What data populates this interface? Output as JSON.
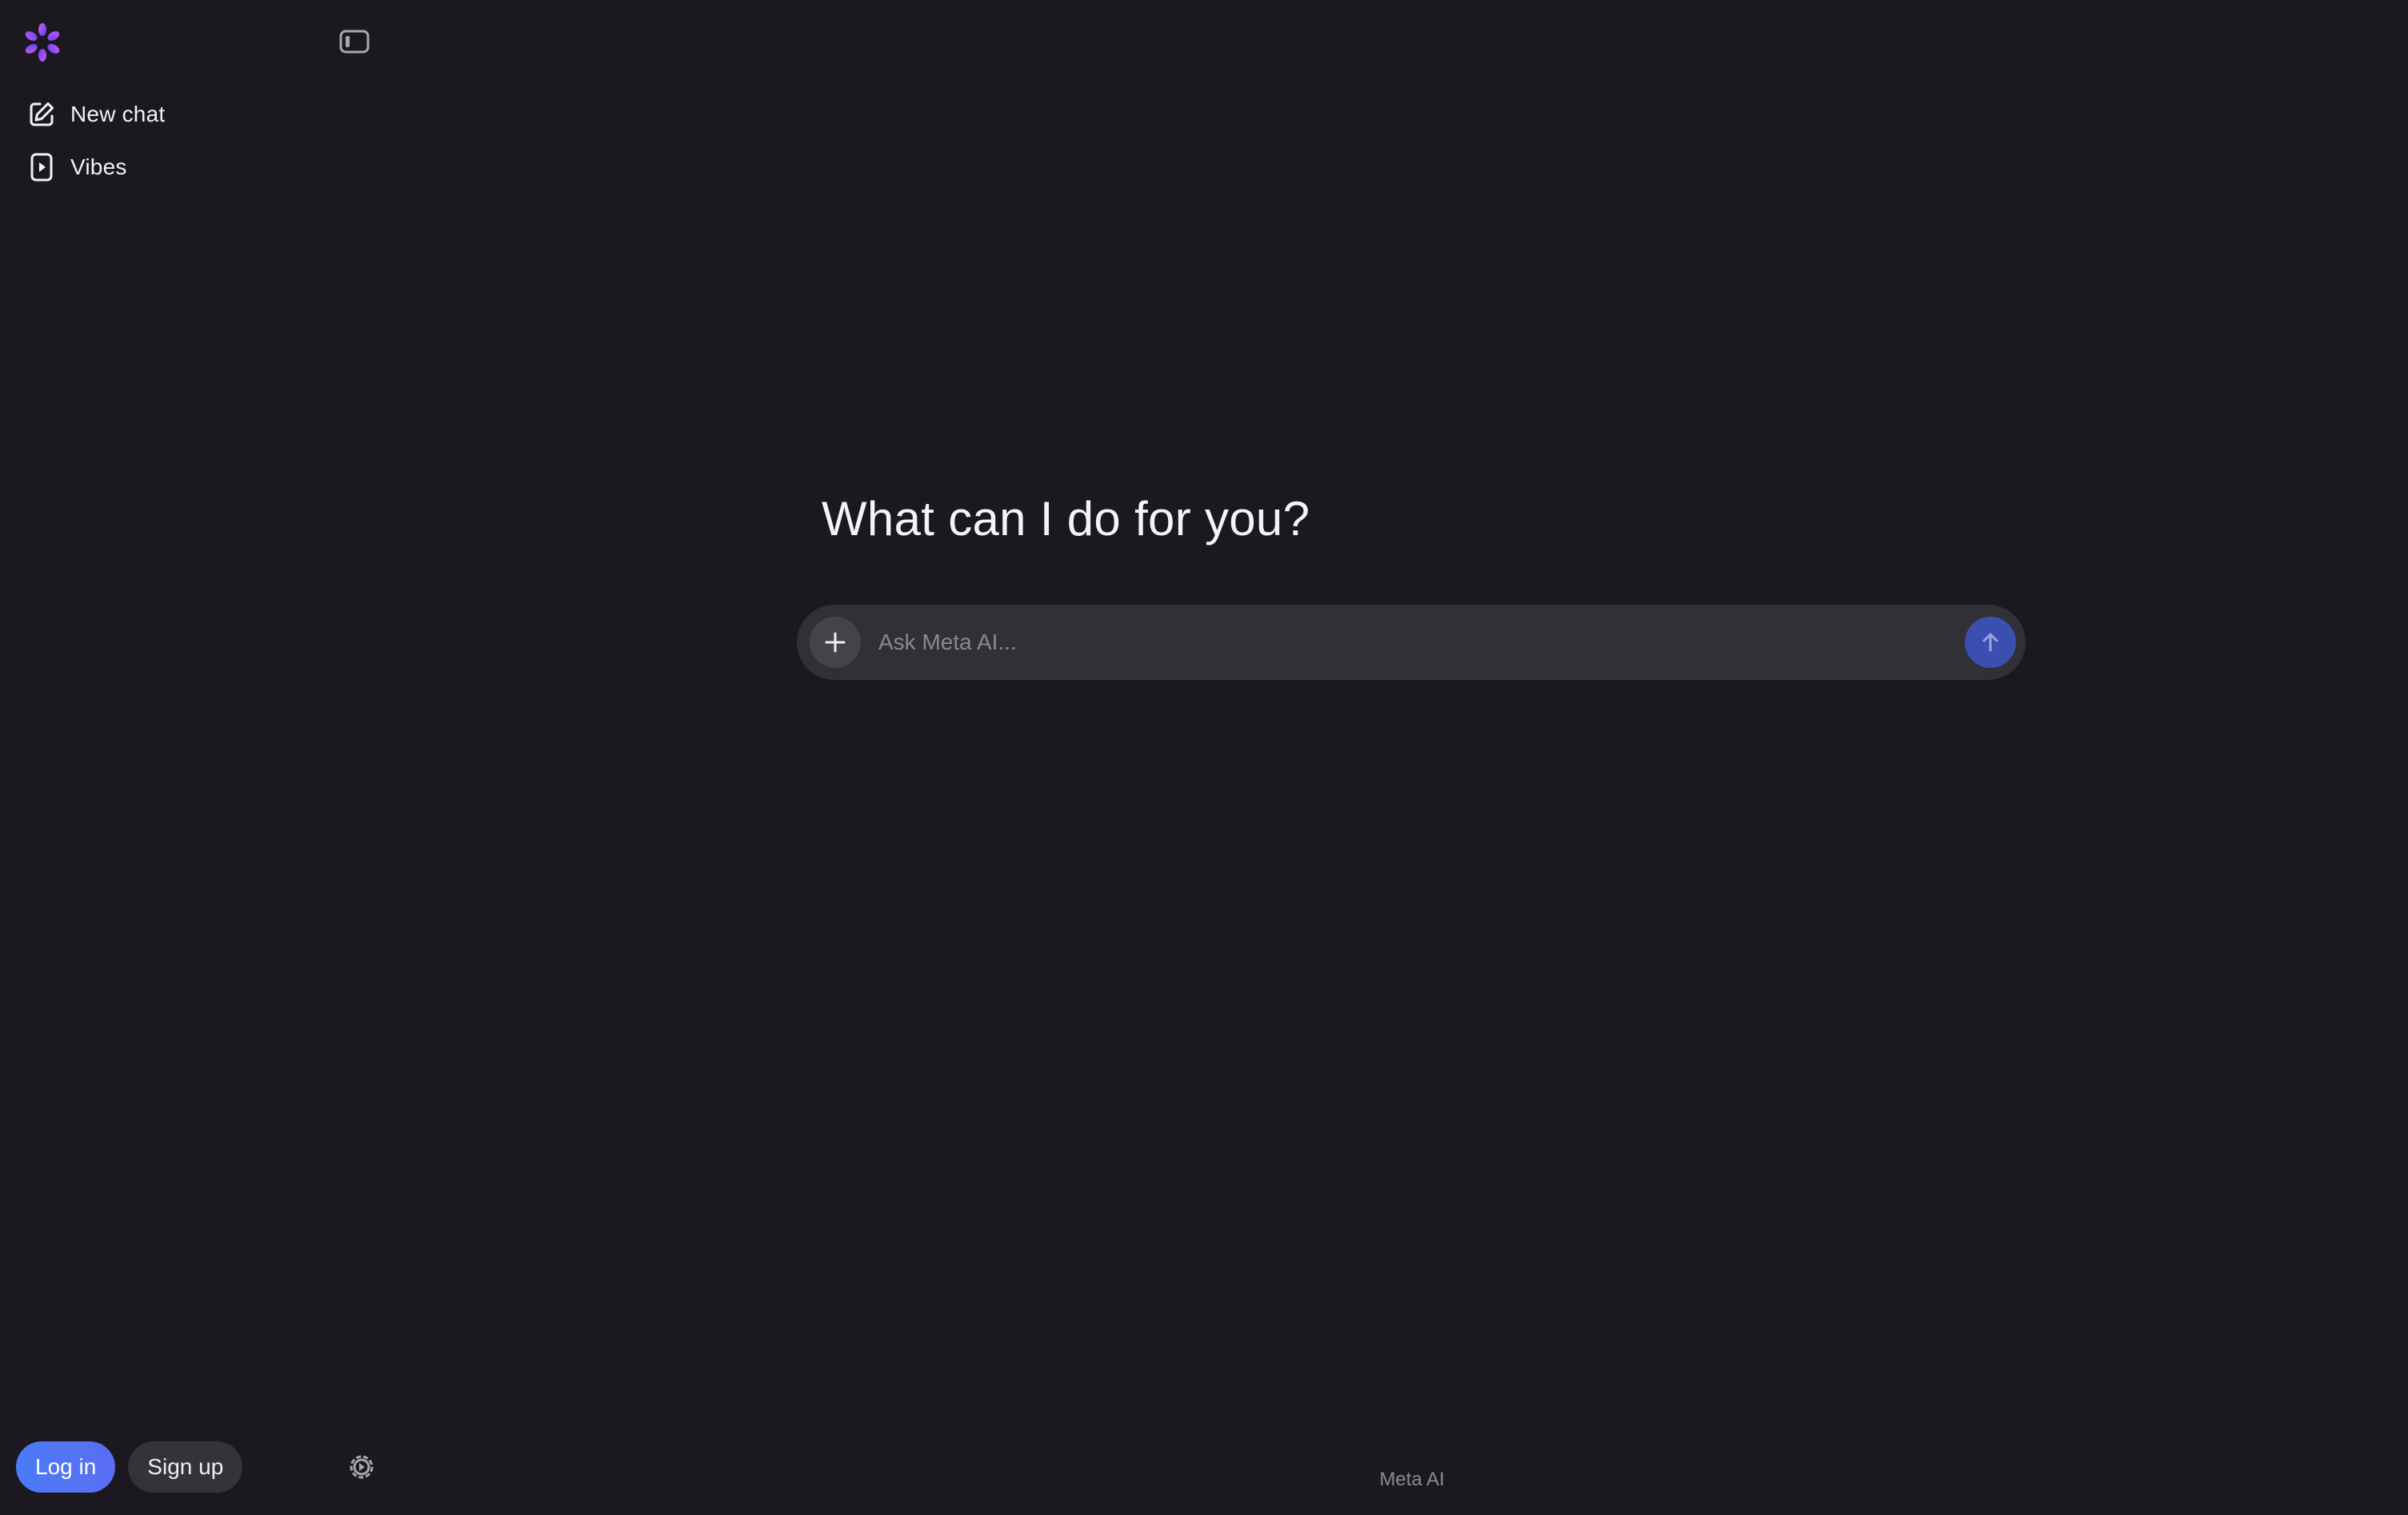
{
  "sidebar": {
    "items": [
      {
        "label": "New chat",
        "icon": "edit-icon"
      },
      {
        "label": "Vibes",
        "icon": "play-square-icon"
      }
    ],
    "login_label": "Log in",
    "signup_label": "Sign up"
  },
  "main": {
    "title": "What can I do for you?",
    "input": {
      "placeholder": "Ask Meta AI...",
      "value": ""
    }
  },
  "footer": {
    "label": "Meta AI"
  },
  "colors": {
    "background": "#1b191f",
    "composer": "#313036",
    "login_button": "#4f6ef7",
    "signup_button": "#35333a",
    "send_button": "#3b4fb0",
    "logo_accent": "#a855f7"
  }
}
